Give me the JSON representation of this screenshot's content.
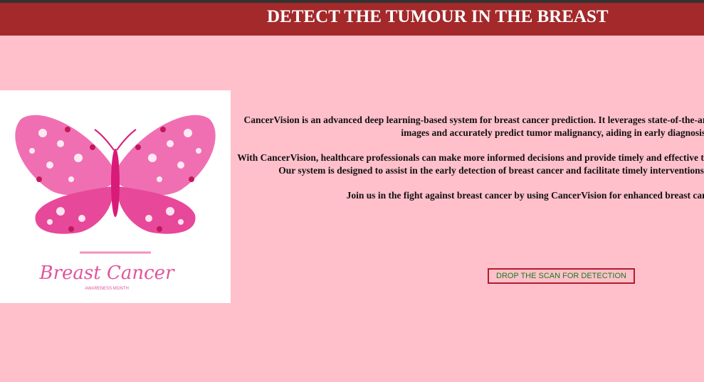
{
  "header": {
    "title": "DETECT THE TUMOUR IN THE BREAST"
  },
  "image": {
    "caption_title": "Breast Cancer",
    "caption_sub": "AWARENESS MONTH"
  },
  "intro": {
    "p1": "CancerVision is an advanced deep learning-based system for breast cancer prediction. It leverages state-of-the-art algorithms to analyze histopathologic images and accurately predict tumor malignancy, aiding in early diagnosis.",
    "p2": "With CancerVision, healthcare professionals can make more informed decisions and provide timely and effective treatment for improved patient outcomes. Our system is designed to assist in the early detection of breast cancer and facilitate timely interventions based on accurate predictions.",
    "p3": "Join us in the fight against breast cancer by using CancerVision for enhanced breast cancer diagnosis."
  },
  "actions": {
    "drop_label": "DROP THE SCAN FOR DETECTION"
  },
  "colors": {
    "header_bg": "#a3292a",
    "page_bg": "#ffc0cb",
    "button_border": "#b11e2a",
    "button_text": "#1a7a1a"
  }
}
